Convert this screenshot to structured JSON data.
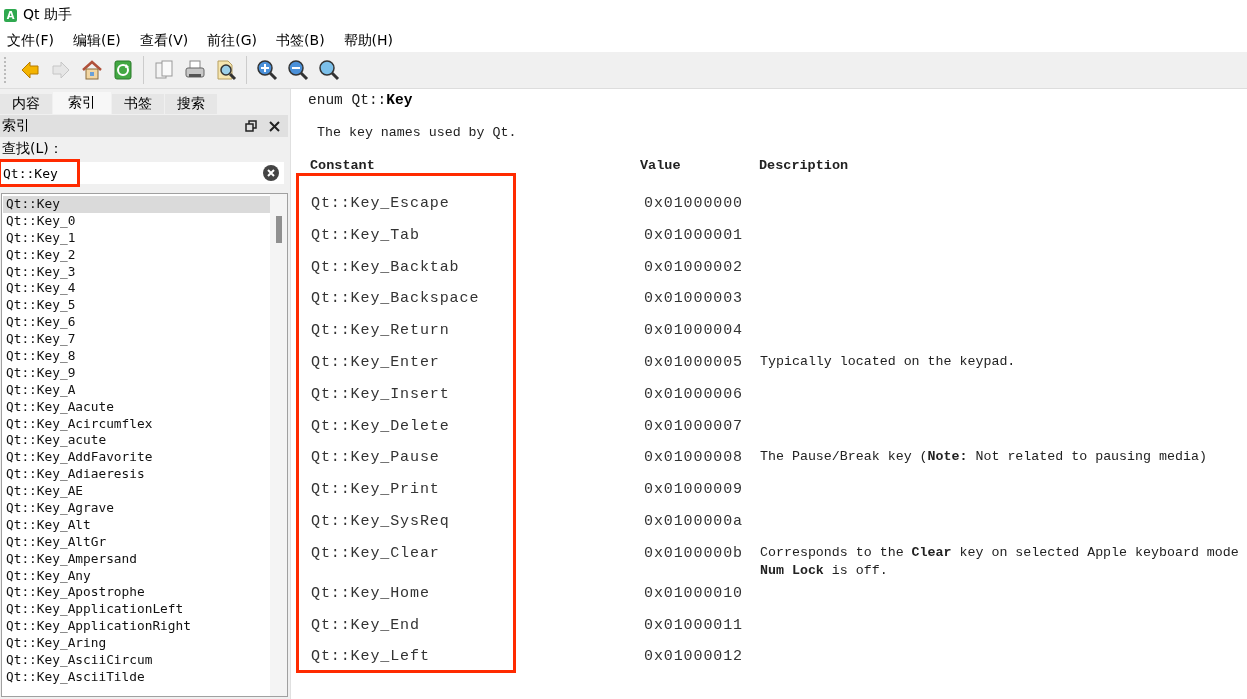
{
  "window": {
    "title": "Qt 助手",
    "icon_text": "A"
  },
  "menu": [
    "文件(F)",
    "编辑(E)",
    "查看(V)",
    "前往(G)",
    "书签(B)",
    "帮助(H)"
  ],
  "toolbar": [
    {
      "kind": "back",
      "disabled": false
    },
    {
      "kind": "forward",
      "disabled": true
    },
    {
      "kind": "home",
      "disabled": false
    },
    {
      "kind": "sync",
      "disabled": false
    },
    {
      "kind": "separator"
    },
    {
      "kind": "copy",
      "disabled": false
    },
    {
      "kind": "print",
      "disabled": false
    },
    {
      "kind": "find",
      "disabled": false
    },
    {
      "kind": "separator"
    },
    {
      "kind": "zoom_in",
      "disabled": false
    },
    {
      "kind": "zoom_out",
      "disabled": false
    },
    {
      "kind": "zoom_reset",
      "disabled": false
    }
  ],
  "sidebar": {
    "tabs": [
      {
        "label": "内容",
        "selected": false
      },
      {
        "label": "索引",
        "selected": true
      },
      {
        "label": "书签",
        "selected": false
      },
      {
        "label": "搜索",
        "selected": false
      }
    ],
    "dock_title": "索引",
    "find_label": "查找(L)：",
    "search": {
      "value": "Qt::Key",
      "highlighted": true
    },
    "items": [
      {
        "label": "Qt::Key",
        "selected": true
      },
      {
        "label": "Qt::Key_0",
        "selected": false
      },
      {
        "label": "Qt::Key_1",
        "selected": false
      },
      {
        "label": "Qt::Key_2",
        "selected": false
      },
      {
        "label": "Qt::Key_3",
        "selected": false
      },
      {
        "label": "Qt::Key_4",
        "selected": false
      },
      {
        "label": "Qt::Key_5",
        "selected": false
      },
      {
        "label": "Qt::Key_6",
        "selected": false
      },
      {
        "label": "Qt::Key_7",
        "selected": false
      },
      {
        "label": "Qt::Key_8",
        "selected": false
      },
      {
        "label": "Qt::Key_9",
        "selected": false
      },
      {
        "label": "Qt::Key_A",
        "selected": false
      },
      {
        "label": "Qt::Key_Aacute",
        "selected": false
      },
      {
        "label": "Qt::Key_Acircumflex",
        "selected": false
      },
      {
        "label": "Qt::Key_acute",
        "selected": false
      },
      {
        "label": "Qt::Key_AddFavorite",
        "selected": false
      },
      {
        "label": "Qt::Key_Adiaeresis",
        "selected": false
      },
      {
        "label": "Qt::Key_AE",
        "selected": false
      },
      {
        "label": "Qt::Key_Agrave",
        "selected": false
      },
      {
        "label": "Qt::Key_Alt",
        "selected": false
      },
      {
        "label": "Qt::Key_AltGr",
        "selected": false
      },
      {
        "label": "Qt::Key_Ampersand",
        "selected": false
      },
      {
        "label": "Qt::Key_Any",
        "selected": false
      },
      {
        "label": "Qt::Key_Apostrophe",
        "selected": false
      },
      {
        "label": "Qt::Key_ApplicationLeft",
        "selected": false
      },
      {
        "label": "Qt::Key_ApplicationRight",
        "selected": false
      },
      {
        "label": "Qt::Key_Aring",
        "selected": false
      },
      {
        "label": "Qt::Key_AsciiCircum",
        "selected": false
      },
      {
        "label": "Qt::Key_AsciiTilde",
        "selected": false
      }
    ]
  },
  "document": {
    "heading": "enum Qt::**Key**",
    "intro": "The key names used by Qt.",
    "table": {
      "columns": [
        "Constant",
        "Value",
        "Description"
      ],
      "constants_highlighted": true,
      "rows": [
        {
          "constant": "Qt::Key_Escape",
          "value": "0x01000000"
        },
        {
          "constant": "Qt::Key_Tab",
          "value": "0x01000001"
        },
        {
          "constant": "Qt::Key_Backtab",
          "value": "0x01000002"
        },
        {
          "constant": "Qt::Key_Backspace",
          "value": "0x01000003"
        },
        {
          "constant": "Qt::Key_Return",
          "value": "0x01000004"
        },
        {
          "constant": "Qt::Key_Enter",
          "value": "0x01000005",
          "description": [
            "Typically located on the keypad."
          ]
        },
        {
          "constant": "Qt::Key_Insert",
          "value": "0x01000006"
        },
        {
          "constant": "Qt::Key_Delete",
          "value": "0x01000007"
        },
        {
          "constant": "Qt::Key_Pause",
          "value": "0x01000008",
          "description": [
            "The Pause/Break key (**Note:** Not related to pausing media)"
          ]
        },
        {
          "constant": "Qt::Key_Print",
          "value": "0x01000009"
        },
        {
          "constant": "Qt::Key_SysReq",
          "value": "0x0100000a"
        },
        {
          "constant": "Qt::Key_Clear",
          "value": "0x0100000b",
          "description": [
            "Corresponds to the **Clear** key on selected Apple keyboard mode",
            "**Num Lock** is off."
          ]
        },
        {
          "constant": "Qt::Key_Home",
          "value": "0x01000010"
        },
        {
          "constant": "Qt::Key_End",
          "value": "0x01000011"
        },
        {
          "constant": "Qt::Key_Left",
          "value": "0x01000012"
        }
      ]
    }
  }
}
